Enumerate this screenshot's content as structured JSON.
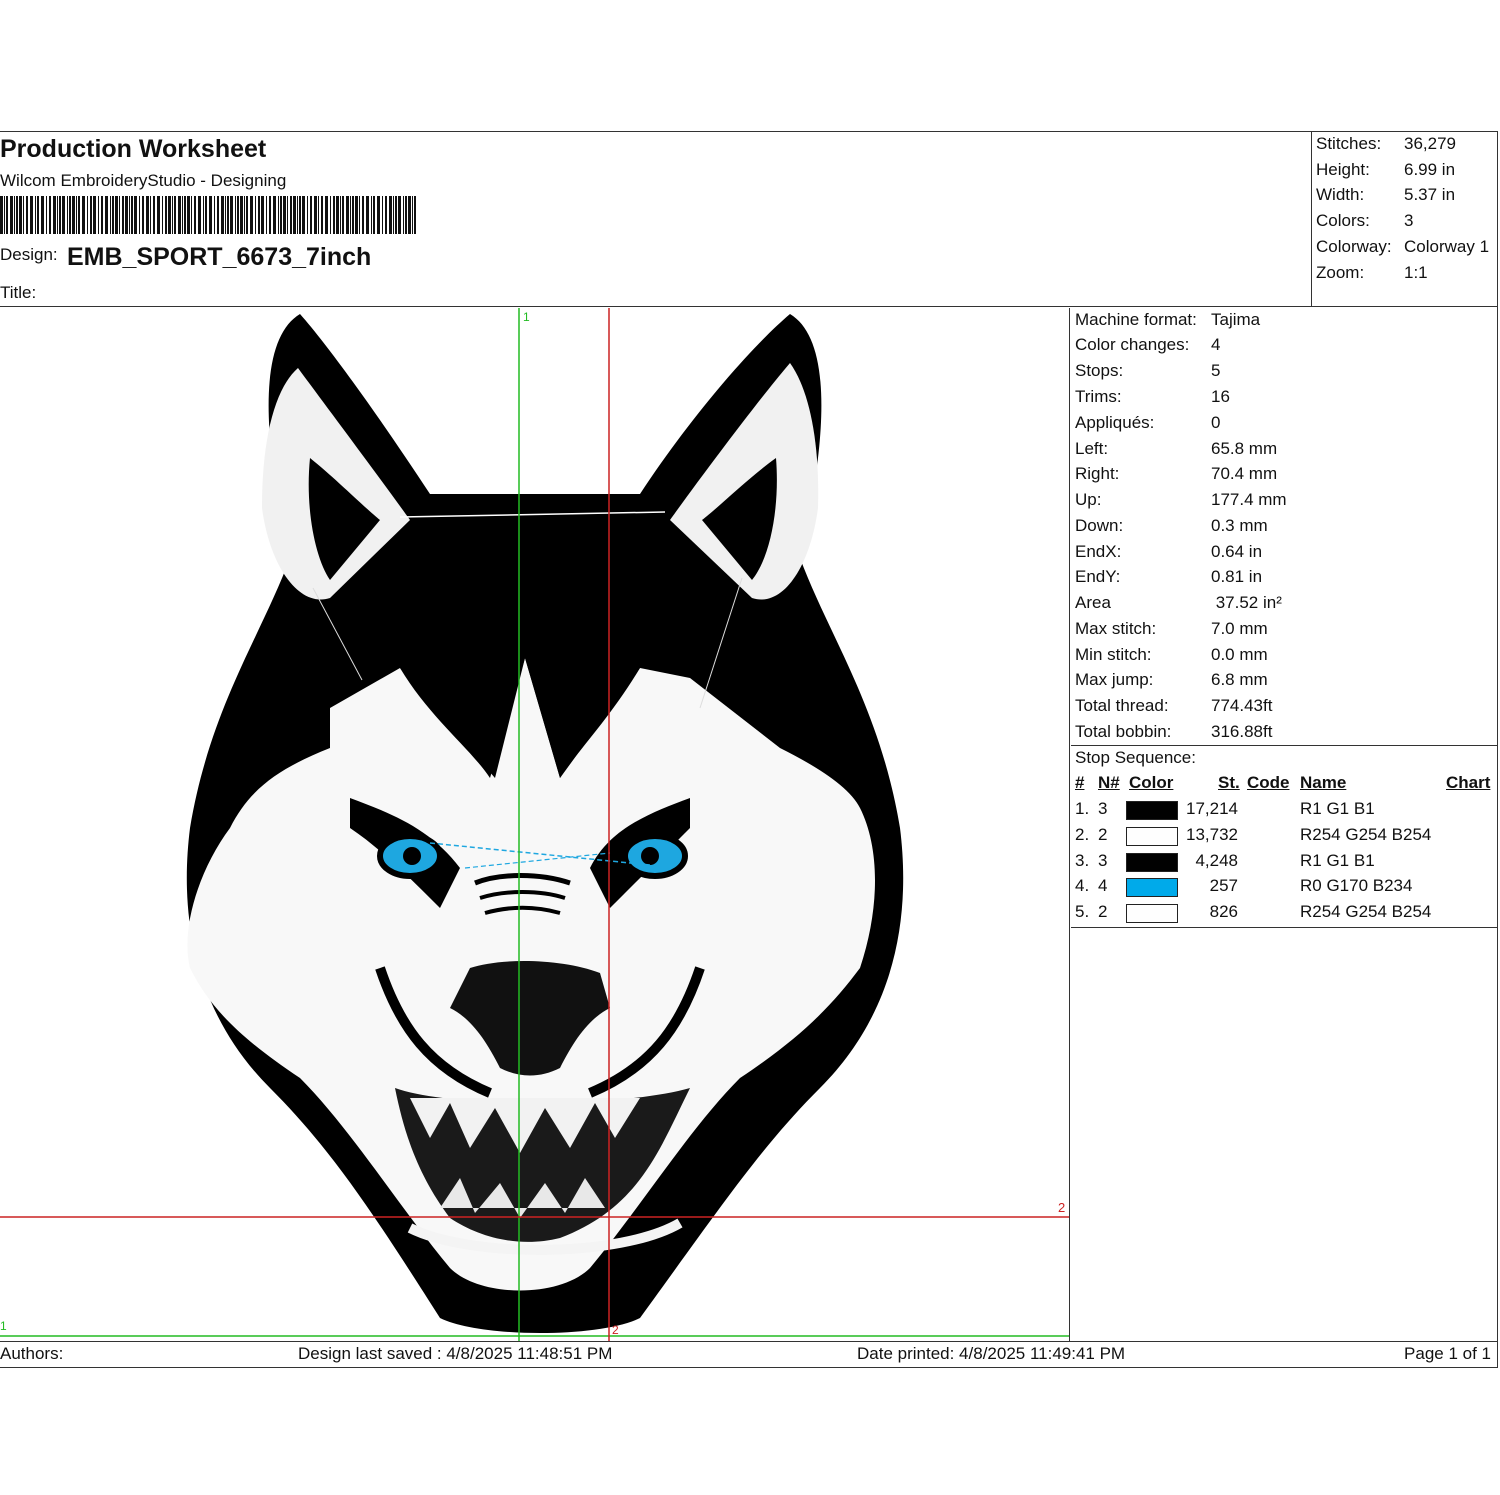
{
  "header": {
    "title": "Production Worksheet",
    "software": "Wilcom EmbroideryStudio - Designing",
    "design_label": "Design:",
    "design_name": "EMB_SPORT_6673_7inch",
    "title_label": "Title:"
  },
  "summary": [
    {
      "label": "Stitches:",
      "value": "36,279"
    },
    {
      "label": "Height:",
      "value": "6.99 in"
    },
    {
      "label": "Width:",
      "value": "5.37 in"
    },
    {
      "label": "Colors:",
      "value": "3"
    },
    {
      "label": "Colorway:",
      "value": "Colorway 1"
    },
    {
      "label": "Zoom:",
      "value": "1:1"
    }
  ],
  "info": [
    {
      "label": "Machine format:",
      "value": "Tajima"
    },
    {
      "label": "Color changes:",
      "value": "4"
    },
    {
      "label": "Stops:",
      "value": "5"
    },
    {
      "label": "Trims:",
      "value": "16"
    },
    {
      "label": "Appliqués:",
      "value": "0"
    },
    {
      "label": "Left:",
      "value": "65.8 mm"
    },
    {
      "label": "Right:",
      "value": "70.4 mm"
    },
    {
      "label": "Up:",
      "value": "177.4 mm"
    },
    {
      "label": "Down:",
      "value": "0.3 mm"
    },
    {
      "label": "EndX:",
      "value": "0.64 in"
    },
    {
      "label": "EndY:",
      "value": "0.81 in"
    },
    {
      "label": "Area",
      "value": " 37.52 in²"
    },
    {
      "label": "Max stitch:",
      "value": "7.0 mm"
    },
    {
      "label": "Min stitch:",
      "value": "0.0 mm"
    },
    {
      "label": "Max jump:",
      "value": "6.8 mm"
    },
    {
      "label": "Total thread:",
      "value": "774.43ft"
    },
    {
      "label": "Total bobbin:",
      "value": "316.88ft"
    }
  ],
  "stop_sequence": {
    "title": "Stop Sequence:",
    "columns": {
      "num": "#",
      "needle": "N#",
      "color": "Color",
      "stitches": "St.",
      "code": "Code",
      "name": "Name",
      "chart": "Chart"
    },
    "rows": [
      {
        "num": "1.",
        "needle": "3",
        "stitches": "17,214",
        "name": "R1 G1 B1",
        "color": "#010101"
      },
      {
        "num": "2.",
        "needle": "2",
        "stitches": "13,732",
        "name": "R254 G254 B254",
        "color": "#fefefe"
      },
      {
        "num": "3.",
        "needle": "3",
        "stitches": "4,248",
        "name": "R1 G1 B1",
        "color": "#010101"
      },
      {
        "num": "4.",
        "needle": "4",
        "stitches": "257",
        "name": "R0 G170 B234",
        "color": "#00aaea"
      },
      {
        "num": "5.",
        "needle": "2",
        "stitches": "826",
        "name": "R254 G254 B254",
        "color": "#fefefe"
      }
    ]
  },
  "canvas": {
    "guide_marker_green_top": "1",
    "guide_marker_green_left": "1",
    "guide_marker_red_right": "2",
    "guide_marker_red_bottom": "2"
  },
  "footer": {
    "authors": "Authors:",
    "saved": "Design last saved : 4/8/2025 11:48:51 PM",
    "printed": "Date printed: 4/8/2025 11:49:41 PM",
    "page": "Page 1 of 1"
  },
  "colors": {
    "guide_green": "#22bb22",
    "guide_red": "#cc2222",
    "eye_blue": "#1ea7e0"
  }
}
